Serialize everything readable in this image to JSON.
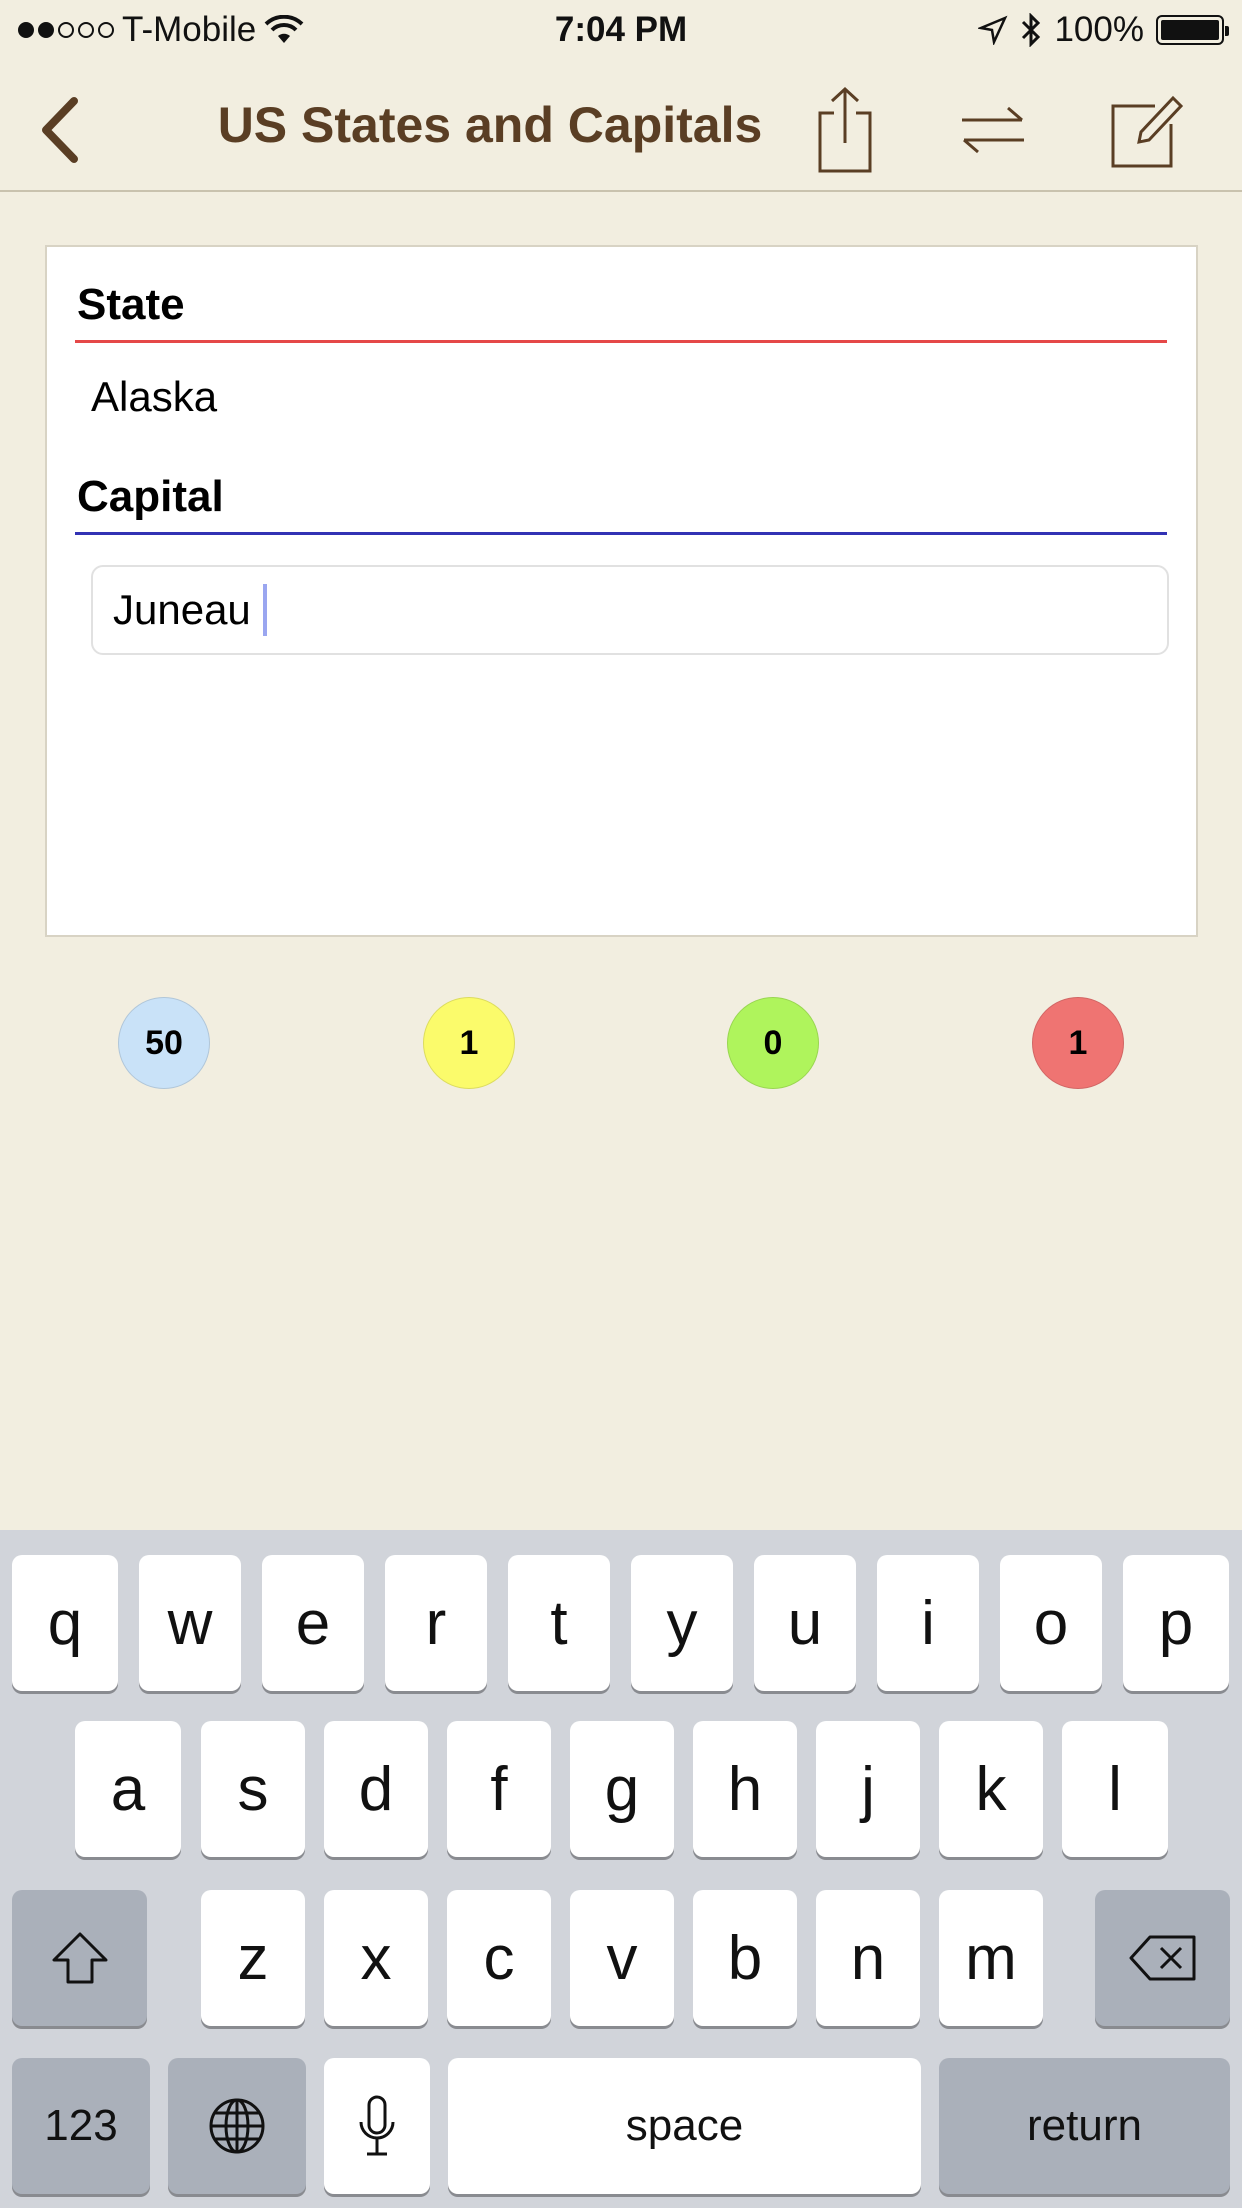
{
  "status_bar": {
    "carrier": "T-Mobile",
    "time": "7:04 PM",
    "battery": "100%",
    "signal_bars": 2
  },
  "nav": {
    "title": "US States and Capitals",
    "icons": [
      "back-chevron-icon",
      "share-icon",
      "swap-icon",
      "edit-icon"
    ]
  },
  "card": {
    "state_label": "State",
    "state_value": "Alaska",
    "capital_label": "Capital",
    "capital_value": "Juneau"
  },
  "counters": [
    {
      "value": "50",
      "color": "#c9e2f8"
    },
    {
      "value": "1",
      "color": "#fbfb6b"
    },
    {
      "value": "0",
      "color": "#aff45c"
    },
    {
      "value": "1",
      "color": "#ef7472"
    }
  ],
  "keyboard": {
    "row1": [
      "q",
      "w",
      "e",
      "r",
      "t",
      "y",
      "u",
      "i",
      "o",
      "p"
    ],
    "row2": [
      "a",
      "s",
      "d",
      "f",
      "g",
      "h",
      "j",
      "k",
      "l"
    ],
    "row3": [
      "z",
      "x",
      "c",
      "v",
      "b",
      "n",
      "m"
    ],
    "numbers_key": "123",
    "space_key": "space",
    "return_key": "return"
  }
}
